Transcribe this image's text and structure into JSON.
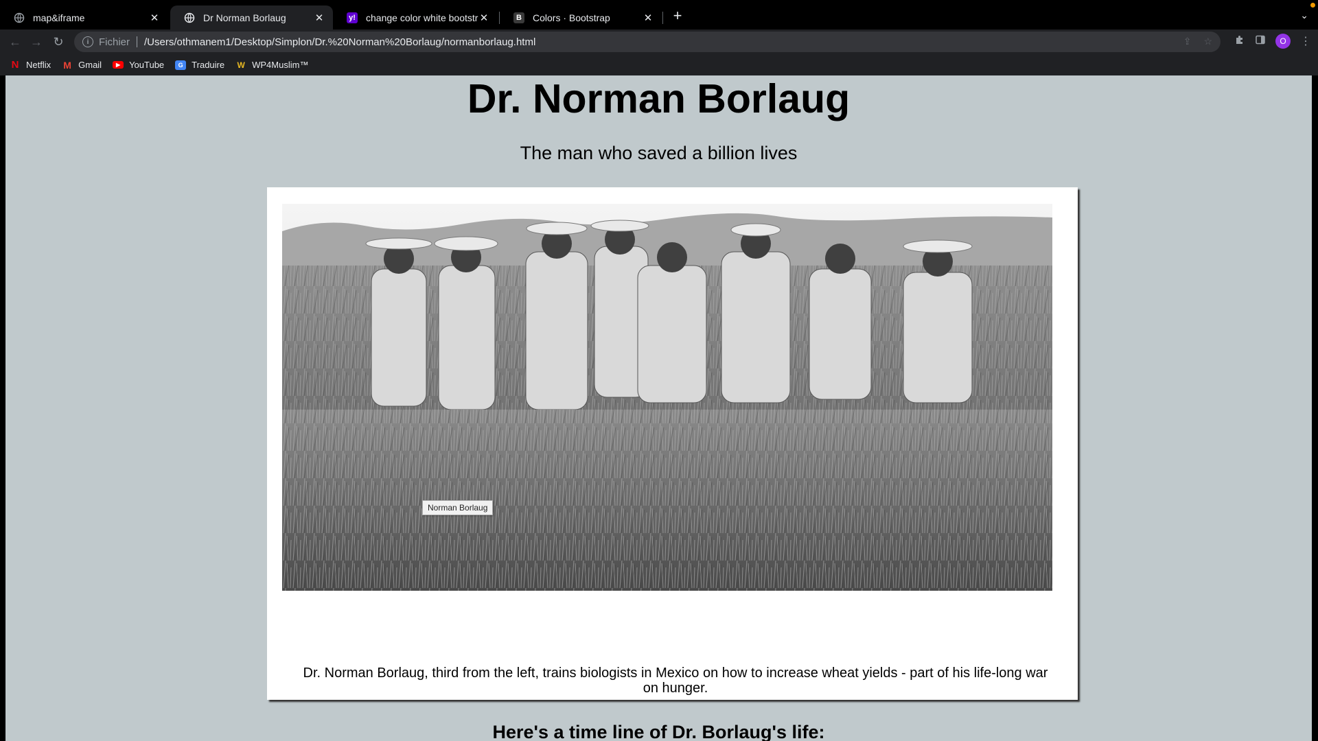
{
  "browser": {
    "tabs": [
      {
        "title": "map&iframe",
        "icon": "globe-icon"
      },
      {
        "title": "Dr Norman Borlaug",
        "icon": "globe-icon"
      },
      {
        "title": "change color white bootstrap -",
        "icon": "yahoo-icon"
      },
      {
        "title": "Colors · Bootstrap",
        "icon": "bootstrap-icon"
      }
    ],
    "omnibox": {
      "scheme": "Fichier",
      "url": "/Users/othmanem1/Desktop/Simplon/Dr.%20Norman%20Borlaug/normanborlaug.html"
    },
    "profile_initial": "O",
    "bookmarks": [
      {
        "label": "Netflix",
        "icon": "netflix-icon",
        "color": "#e50914"
      },
      {
        "label": "Gmail",
        "icon": "gmail-icon",
        "color": "#ea4335"
      },
      {
        "label": "YouTube",
        "icon": "youtube-icon",
        "color": "#ff0000"
      },
      {
        "label": "Traduire",
        "icon": "translate-icon",
        "color": "#4285f4"
      },
      {
        "label": "WP4Muslim™",
        "icon": "wp4muslim-icon",
        "color": "#e8b923"
      }
    ]
  },
  "page": {
    "title": "Dr. Norman Borlaug",
    "subtitle": "The man who saved a billion lives",
    "image_tooltip": "Norman Borlaug",
    "caption": "Dr. Norman Borlaug, third from the left, trains biologists in Mexico on how to increase wheat yields - part of his life-long war on hunger.",
    "timeline_heading": "Here's a time line of Dr. Borlaug's life:",
    "background_color": "#c0c9cc"
  }
}
